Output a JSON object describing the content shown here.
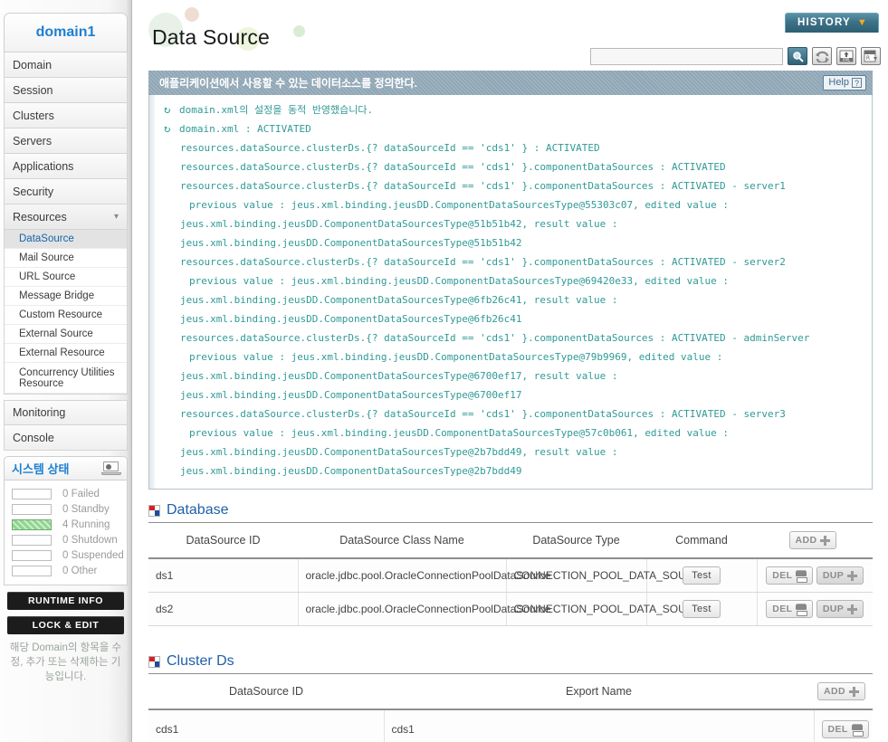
{
  "sidebar": {
    "domain_label": "domain1",
    "nav": [
      {
        "label": "Domain"
      },
      {
        "label": "Session"
      },
      {
        "label": "Clusters"
      },
      {
        "label": "Servers"
      },
      {
        "label": "Applications"
      },
      {
        "label": "Security"
      },
      {
        "label": "Resources",
        "expanded": true
      }
    ],
    "sub_items": [
      {
        "label": "DataSource",
        "active": true
      },
      {
        "label": "Mail Source"
      },
      {
        "label": "URL Source"
      },
      {
        "label": "Message Bridge"
      },
      {
        "label": "Custom Resource"
      },
      {
        "label": "External Source"
      },
      {
        "label": "External Resource"
      },
      {
        "label": "Concurrency Utilities Resource"
      }
    ],
    "nav_tail": [
      {
        "label": "Monitoring"
      },
      {
        "label": "Console"
      }
    ],
    "status": {
      "title": "시스템 상태",
      "rows": [
        {
          "count": "0",
          "label": "Failed"
        },
        {
          "count": "0",
          "label": "Standby"
        },
        {
          "count": "4",
          "label": "Running",
          "active": true
        },
        {
          "count": "0",
          "label": "Shutdown"
        },
        {
          "count": "0",
          "label": "Suspended"
        },
        {
          "count": "0",
          "label": "Other"
        }
      ]
    },
    "runtime_info_label": "RUNTIME INFO",
    "lock_edit_label": "LOCK & EDIT",
    "note": "해당 Domain의 항목을 수정, 추가 또는 삭제하는 기능입니다."
  },
  "header": {
    "title": "Data Source",
    "history_label": "HISTORY",
    "history_arrow": "chevron-down-icon"
  },
  "toolbar": {
    "search_value": "",
    "search_placeholder": "",
    "icons": [
      {
        "name": "search-icon",
        "glyph": "🔍"
      },
      {
        "name": "refresh-icon",
        "glyph": "⟳"
      },
      {
        "name": "xml-upload-icon",
        "glyph": "XML"
      },
      {
        "name": "report-export-icon",
        "glyph": "R"
      }
    ]
  },
  "description": {
    "text": "애플리케이션에서 사용할 수 있는 데이터소스를 정의한다.",
    "help_label": "Help"
  },
  "log": {
    "lines": [
      {
        "indent": "l0",
        "icon": true,
        "text": "domain.xml의 설정을 동적 반영했습니다."
      },
      {
        "indent": "l0",
        "icon": true,
        "text": "domain.xml : ACTIVATED"
      },
      {
        "indent": "ind0",
        "icon": false,
        "text": "resources.dataSource.clusterDs.{? dataSourceId == 'cds1' } : ACTIVATED"
      },
      {
        "indent": "ind0",
        "icon": false,
        "text": "resources.dataSource.clusterDs.{? dataSourceId == 'cds1' }.componentDataSources : ACTIVATED"
      },
      {
        "indent": "ind0",
        "icon": false,
        "text": "resources.dataSource.clusterDs.{? dataSourceId == 'cds1' }.componentDataSources : ACTIVATED - server1"
      },
      {
        "indent": "ind2",
        "icon": false,
        "text": "previous value : jeus.xml.binding.jeusDD.ComponentDataSourcesType@55303c07, edited value :"
      },
      {
        "indent": "ind0",
        "icon": false,
        "text": "jeus.xml.binding.jeusDD.ComponentDataSourcesType@51b51b42, result value :"
      },
      {
        "indent": "ind0",
        "icon": false,
        "text": "jeus.xml.binding.jeusDD.ComponentDataSourcesType@51b51b42"
      },
      {
        "indent": "ind0",
        "icon": false,
        "text": "resources.dataSource.clusterDs.{? dataSourceId == 'cds1' }.componentDataSources : ACTIVATED - server2"
      },
      {
        "indent": "ind2",
        "icon": false,
        "text": "previous value : jeus.xml.binding.jeusDD.ComponentDataSourcesType@69420e33, edited value :"
      },
      {
        "indent": "ind0",
        "icon": false,
        "text": "jeus.xml.binding.jeusDD.ComponentDataSourcesType@6fb26c41, result value :"
      },
      {
        "indent": "ind0",
        "icon": false,
        "text": "jeus.xml.binding.jeusDD.ComponentDataSourcesType@6fb26c41"
      },
      {
        "indent": "ind0",
        "icon": false,
        "text": "resources.dataSource.clusterDs.{? dataSourceId == 'cds1' }.componentDataSources : ACTIVATED - adminServer"
      },
      {
        "indent": "ind2",
        "icon": false,
        "text": "previous value : jeus.xml.binding.jeusDD.ComponentDataSourcesType@79b9969, edited value :"
      },
      {
        "indent": "ind0",
        "icon": false,
        "text": "jeus.xml.binding.jeusDD.ComponentDataSourcesType@6700ef17, result value :"
      },
      {
        "indent": "ind0",
        "icon": false,
        "text": "jeus.xml.binding.jeusDD.ComponentDataSourcesType@6700ef17"
      },
      {
        "indent": "ind0",
        "icon": false,
        "text": "resources.dataSource.clusterDs.{? dataSourceId == 'cds1' }.componentDataSources : ACTIVATED - server3"
      },
      {
        "indent": "ind2",
        "icon": false,
        "text": "previous value : jeus.xml.binding.jeusDD.ComponentDataSourcesType@57c0b061, edited value :"
      },
      {
        "indent": "ind0",
        "icon": false,
        "text": "jeus.xml.binding.jeusDD.ComponentDataSourcesType@2b7bdd49, result value :"
      },
      {
        "indent": "ind0",
        "icon": false,
        "text": "jeus.xml.binding.jeusDD.ComponentDataSourcesType@2b7bdd49"
      }
    ]
  },
  "database_section": {
    "title": "Database",
    "add_label": "ADD",
    "columns": [
      "DataSource ID",
      "DataSource Class Name",
      "DataSource Type",
      "Command",
      ""
    ],
    "rows": [
      {
        "id": "ds1",
        "class_name": "oracle.jdbc.pool.OracleConnectionPoolDataSource",
        "type": "CONNECTION_POOL_DATA_SOURCE",
        "command": "Test",
        "del_label": "DEL",
        "dup_label": "DUP"
      },
      {
        "id": "ds2",
        "class_name": "oracle.jdbc.pool.OracleConnectionPoolDataSource",
        "type": "CONNECTION_POOL_DATA_SOURCE",
        "command": "Test",
        "del_label": "DEL",
        "dup_label": "DUP"
      }
    ]
  },
  "cluster_ds_section": {
    "title": "Cluster Ds",
    "add_label": "ADD",
    "columns": [
      "DataSource ID",
      "Export Name",
      ""
    ],
    "rows": [
      {
        "id": "cds1",
        "export_name": "cds1",
        "del_label": "DEL"
      }
    ]
  },
  "colors": {
    "accent_blue": "#1f5fa8",
    "domain_blue": "#1d7fd1",
    "log_teal": "#2f9a96",
    "desc_bar": "#8fa6b5",
    "history_teal": "#3d7186",
    "running_green": "#8fd48f",
    "icon_red": "#d81f26",
    "icon_navy": "#1a4f9c"
  }
}
